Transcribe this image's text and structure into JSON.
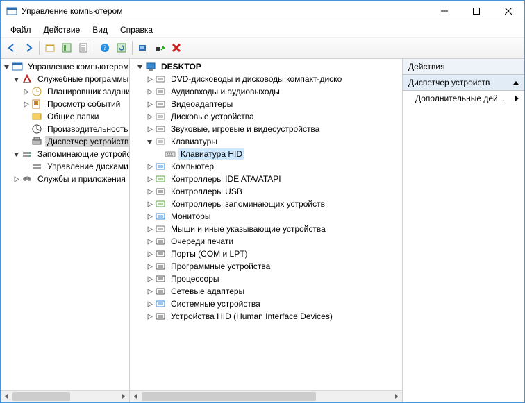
{
  "window": {
    "title": "Управление компьютером"
  },
  "menubar": [
    "Файл",
    "Действие",
    "Вид",
    "Справка"
  ],
  "left_tree": {
    "root": "Управление компьютером (л",
    "groups": [
      {
        "label": "Служебные программы",
        "items": [
          "Планировщик заданий",
          "Просмотр событий",
          "Общие папки",
          "Производительность",
          "Диспетчер устройств"
        ],
        "selected_index": 4
      },
      {
        "label": "Запоминающие устройс",
        "items": [
          "Управление дисками"
        ]
      },
      {
        "label": "Службы и приложения",
        "items": []
      }
    ]
  },
  "center_tree": {
    "root": "DESKTOP",
    "items": [
      {
        "label": "DVD-дисководы и дисководы компакт-диско",
        "expandable": true
      },
      {
        "label": "Аудиовходы и аудиовыходы",
        "expandable": true
      },
      {
        "label": "Видеоадаптеры",
        "expandable": true
      },
      {
        "label": "Дисковые устройства",
        "expandable": true
      },
      {
        "label": "Звуковые, игровые и видеоустройства",
        "expandable": true
      },
      {
        "label": "Клавиатуры",
        "expandable": true,
        "expanded": true,
        "children": [
          {
            "label": "Клавиатура HID",
            "selected": true
          }
        ]
      },
      {
        "label": "Компьютер",
        "expandable": true
      },
      {
        "label": "Контроллеры IDE ATA/ATAPI",
        "expandable": true
      },
      {
        "label": "Контроллеры USB",
        "expandable": true
      },
      {
        "label": "Контроллеры запоминающих устройств",
        "expandable": true
      },
      {
        "label": "Мониторы",
        "expandable": true
      },
      {
        "label": "Мыши и иные указывающие устройства",
        "expandable": true
      },
      {
        "label": "Очереди печати",
        "expandable": true
      },
      {
        "label": "Порты (COM и LPT)",
        "expandable": true
      },
      {
        "label": "Программные устройства",
        "expandable": true
      },
      {
        "label": "Процессоры",
        "expandable": true
      },
      {
        "label": "Сетевые адаптеры",
        "expandable": true
      },
      {
        "label": "Системные устройства",
        "expandable": true
      },
      {
        "label": "Устройства HID (Human Interface Devices)",
        "expandable": true
      }
    ]
  },
  "actions": {
    "header": "Действия",
    "sub": "Диспетчер устройств",
    "more": "Дополнительные дей..."
  },
  "icons": {
    "dvd": "#7a7a7a",
    "audio": "#6b6b6b",
    "video": "#6b6b6b",
    "disk": "#8a8a8a",
    "sound": "#6b6b6b",
    "keyboard": "#8a8a8a",
    "computer": "#3a8ad6",
    "ide": "#5fa44a",
    "usb": "#555",
    "storage": "#5fa44a",
    "monitor": "#3a8ad6",
    "mouse": "#777",
    "print": "#555",
    "port": "#555",
    "soft": "#555",
    "cpu": "#555",
    "net": "#555",
    "sys": "#3a8ad6",
    "hid": "#555"
  }
}
